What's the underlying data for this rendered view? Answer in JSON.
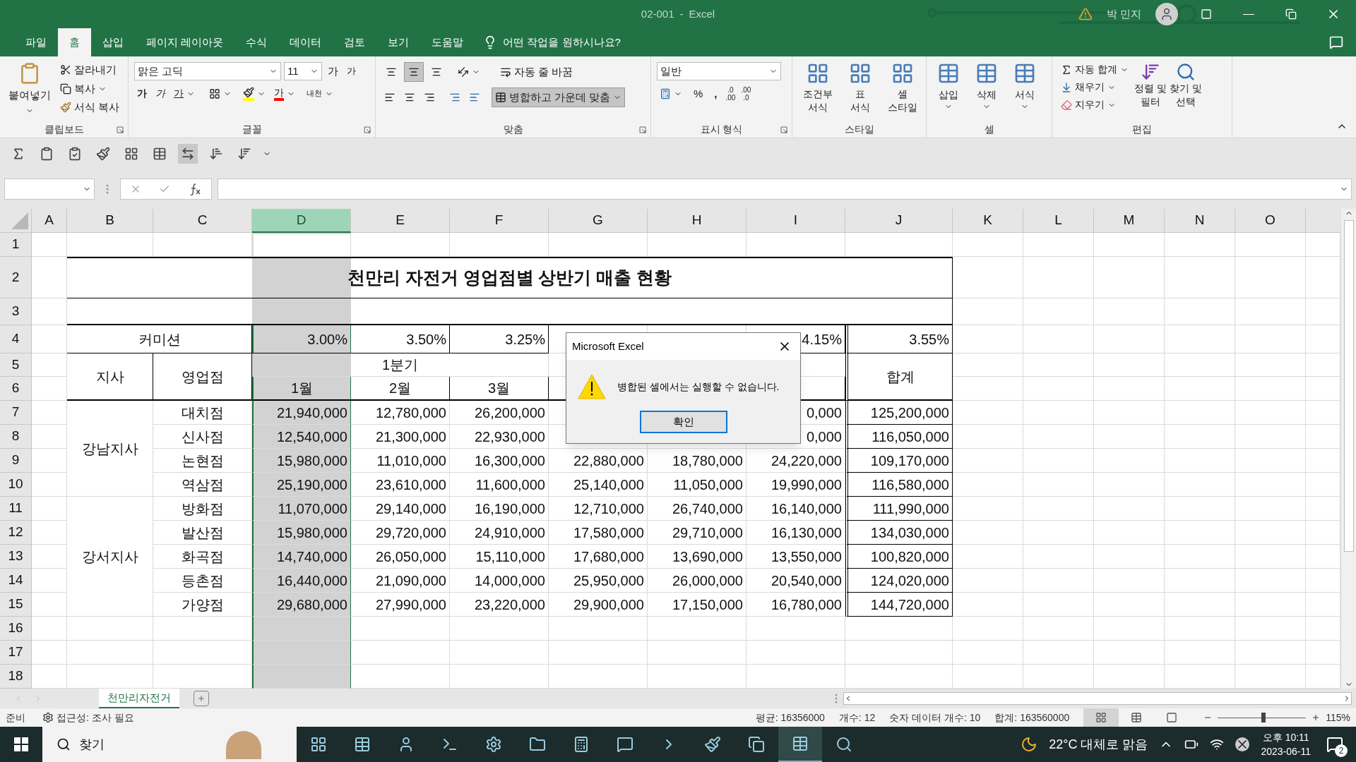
{
  "window": {
    "file_name": "02-001",
    "separator": "-",
    "app_name": "Excel",
    "user": "박 민지"
  },
  "menu_tabs": [
    {
      "label": "파일",
      "selected": false
    },
    {
      "label": "홈",
      "selected": true
    },
    {
      "label": "삽입",
      "selected": false
    },
    {
      "label": "페이지 레이아웃",
      "selected": false
    },
    {
      "label": "수식",
      "selected": false
    },
    {
      "label": "데이터",
      "selected": false
    },
    {
      "label": "검토",
      "selected": false
    },
    {
      "label": "보기",
      "selected": false
    },
    {
      "label": "도움말",
      "selected": false
    }
  ],
  "tell_me": "어떤 작업을 원하시나요?",
  "ribbon": {
    "clipboard": {
      "paste": "붙여넣기",
      "cut": "잘라내기",
      "copy": "복사",
      "format_painter": "서식 복사",
      "label": "클립보드"
    },
    "font": {
      "font_name": "맑은 고딕",
      "font_size": "11",
      "grow": "가",
      "shrink": "가",
      "bold": "가",
      "italic": "가",
      "underline": "가",
      "font_color": "가",
      "phonetic": "내천",
      "label": "글꼴"
    },
    "alignment": {
      "top_align_pressed": false,
      "middle_align_pressed": true,
      "bottom_align_pressed": false,
      "wrap_text": "자동 줄 바꿈",
      "merge": {
        "label": "병합하고 가운데 맞춤",
        "pressed": true
      },
      "label": "맞춤"
    },
    "number": {
      "format": "일반",
      "percent": "%",
      "comma": ",",
      "increase_decimal": [
        ".0",
        ".00"
      ],
      "decrease_decimal": [
        ".00",
        ".0"
      ],
      "label": "표시 형식"
    },
    "styles": {
      "buttons": [
        {
          "lines": [
            "조건부",
            "서식"
          ]
        },
        {
          "lines": [
            "표",
            "서식"
          ]
        },
        {
          "lines": [
            "셀",
            "스타일"
          ]
        }
      ],
      "label": "스타일"
    },
    "cells": {
      "buttons": [
        "삽입",
        "삭제",
        "서식"
      ],
      "label": "셀"
    },
    "editing": {
      "autosum": "자동 합계",
      "fill": "채우기",
      "clear": "지우기",
      "sort": [
        "정렬 및",
        "필터"
      ],
      "find": [
        "찾기 및",
        "선택"
      ],
      "label": "편집"
    }
  },
  "columns": [
    {
      "letter": "A",
      "selected": false
    },
    {
      "letter": "B",
      "selected": false
    },
    {
      "letter": "C",
      "selected": false
    },
    {
      "letter": "D",
      "selected": true
    },
    {
      "letter": "E",
      "selected": false
    },
    {
      "letter": "F",
      "selected": false
    },
    {
      "letter": "G",
      "selected": false
    },
    {
      "letter": "H",
      "selected": false
    },
    {
      "letter": "I",
      "selected": false
    },
    {
      "letter": "J",
      "selected": false
    },
    {
      "letter": "K",
      "selected": false
    },
    {
      "letter": "L",
      "selected": false
    },
    {
      "letter": "M",
      "selected": false
    },
    {
      "letter": "N",
      "selected": false
    },
    {
      "letter": "O",
      "selected": false
    }
  ],
  "row_numbers": [
    "1",
    "2",
    "3",
    "4",
    "5",
    "6",
    "7",
    "8",
    "9",
    "10",
    "11",
    "12",
    "13",
    "14",
    "15",
    "16",
    "17",
    "18"
  ],
  "sheet": {
    "title": "천만리 자전거 영업점별 상반기 매출 현황",
    "commission": {
      "label": "커미션",
      "rates": [
        "3.00%",
        "3.50%",
        "3.25%",
        "4.15%",
        "3.55%"
      ]
    },
    "header": {
      "branch": "지사",
      "store": "영업점",
      "quarter": "1분기",
      "months": [
        "1월",
        "2월",
        "3월"
      ],
      "total": "합계"
    },
    "regions": [
      {
        "name": "강남지사",
        "stores": [
          {
            "name": "대치점",
            "sales": [
              "21,940,000",
              "12,780,000",
              "26,200,000",
              "0,000",
              "125,200,000"
            ]
          },
          {
            "name": "신사점",
            "sales": [
              "12,540,000",
              "21,300,000",
              "22,930,000",
              "0,000",
              "116,050,000"
            ]
          },
          {
            "name": "논현점",
            "sales": [
              "15,980,000",
              "11,010,000",
              "16,300,000",
              "22,880,000",
              "18,780,000",
              "24,220,000",
              "109,170,000"
            ]
          },
          {
            "name": "역삼점",
            "sales": [
              "25,190,000",
              "23,610,000",
              "11,600,000",
              "25,140,000",
              "11,050,000",
              "19,990,000",
              "116,580,000"
            ]
          }
        ]
      },
      {
        "name": "강서지사",
        "stores": [
          {
            "name": "방화점",
            "sales": [
              "11,070,000",
              "29,140,000",
              "16,190,000",
              "12,710,000",
              "26,740,000",
              "16,140,000",
              "111,990,000"
            ]
          },
          {
            "name": "발산점",
            "sales": [
              "15,980,000",
              "29,720,000",
              "24,910,000",
              "17,580,000",
              "29,710,000",
              "16,130,000",
              "134,030,000"
            ]
          },
          {
            "name": "화곡점",
            "sales": [
              "14,740,000",
              "26,050,000",
              "15,110,000",
              "17,680,000",
              "13,690,000",
              "13,550,000",
              "100,820,000"
            ]
          },
          {
            "name": "등촌점",
            "sales": [
              "16,440,000",
              "21,090,000",
              "14,000,000",
              "25,950,000",
              "26,000,000",
              "20,540,000",
              "124,020,000"
            ]
          },
          {
            "name": "가양점",
            "sales": [
              "29,680,000",
              "27,990,000",
              "23,220,000",
              "29,900,000",
              "17,150,000",
              "16,780,000",
              "144,720,000"
            ]
          }
        ]
      }
    ]
  },
  "dialog": {
    "title": "Microsoft Excel",
    "message": "병합된 셀에서는 실행할 수 없습니다.",
    "button": "확인"
  },
  "sheet_tabs": [
    {
      "label": "천만리자전거",
      "selected": true
    }
  ],
  "status_bar": {
    "ready": "준비",
    "accessibility": "접근성: 조사 필요",
    "average": "평균: 16356000",
    "count": "개수: 12",
    "numeric_count": "숫자 데이터 개수: 10",
    "sum": "합계: 163560000",
    "views": [
      {
        "kind": "normal",
        "selected": true
      },
      {
        "kind": "page_layout",
        "selected": false
      },
      {
        "kind": "page_break",
        "selected": false
      }
    ],
    "zoom": {
      "level": 0.52,
      "reading": "115%"
    }
  },
  "taskbar": {
    "search": "찾기",
    "weather": "22°C 대체로 맑음",
    "time": "오후 10:11",
    "date": "2023-06-11",
    "notifications": "2"
  }
}
